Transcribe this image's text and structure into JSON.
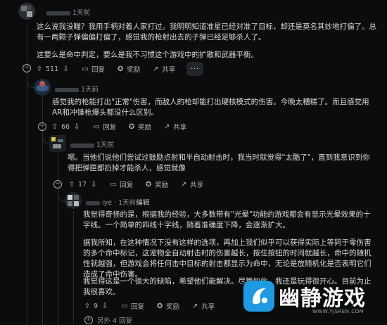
{
  "comment1": {
    "time": "1天前",
    "paragraphs": [
      "这么说我没瞄？我用手柄对着人家打过。我明明知道准星已经对准了目标，却还是莫名其妙地打偏了。总有一两颗子弹偏偏打偏了，感觉我的枪射出去的子弹已经足够杀人了。",
      "这要么是命中判定，要么是我不习惯这个游戏中的扩散和武器平衡。"
    ],
    "votes": "511",
    "reply_label": "回复",
    "award_label": "奖励",
    "share_label": "共享",
    "more_label": "···"
  },
  "comment2": {
    "time": "1天前",
    "text": "感觉我的枪能打出\"正常\"伤害，而敌人的枪却能打出硬核模式的伤害。今晚太糟糕了。而且感觉用AR和冲锋枪爆头都没什么区别。",
    "votes": "66",
    "reply_label": "回复",
    "award_label": "奖励",
    "share_label": "共享"
  },
  "comment3": {
    "time": "1天前",
    "text": "嗯。当他们说他们尝试过鼓励点射和半自动射击时，我当时就觉得\"太酷了\"，直到我意识到你得把弹匣都扔掉才能杀人，感觉就像",
    "votes": "17",
    "reply_label": "回复",
    "award_label": "奖励",
    "share_label": "共享"
  },
  "comment4": {
    "name_suffix": "iye",
    "time": "1天前",
    "edited": "编辑",
    "paragraphs": [
      "我觉得奇怪的是，根据我的经验，大多数带有\"光晕\"功能的游戏都会有显示光晕效果的十字线。一个简单的四线十字线，随着准确度下降，会逐渐扩大。",
      "据我所知，在这种情况下没有这样的选项，再加上我们似乎可以获得实际上等同于零伤害的多个命中标记，这宠物全自动射击时的伤害越长，按住按钮的时间就越长，命中的随机性就越强，但游戏会将任何击中目标的射击都显示为命中，无论是放随机化是否表明它们造成了命中伤害。",
      "我觉得这是一个很大的缺陷，希望他们能解决。尽管如此，我还是玩得很开心。目前为止我很喜欢。"
    ],
    "votes": "9",
    "reply_label": "回复",
    "award_label": "奖励",
    "share_label": "共享"
  },
  "more_replies": "另外 4 回复",
  "watermark": {
    "brand": "幽静游戏",
    "url": "WWW.YJSREN.COM"
  },
  "colors": {
    "background": "#0b0c0d",
    "text": "#d7dadc",
    "muted": "#8d9296",
    "brand_blue": "#1f9ae0"
  }
}
